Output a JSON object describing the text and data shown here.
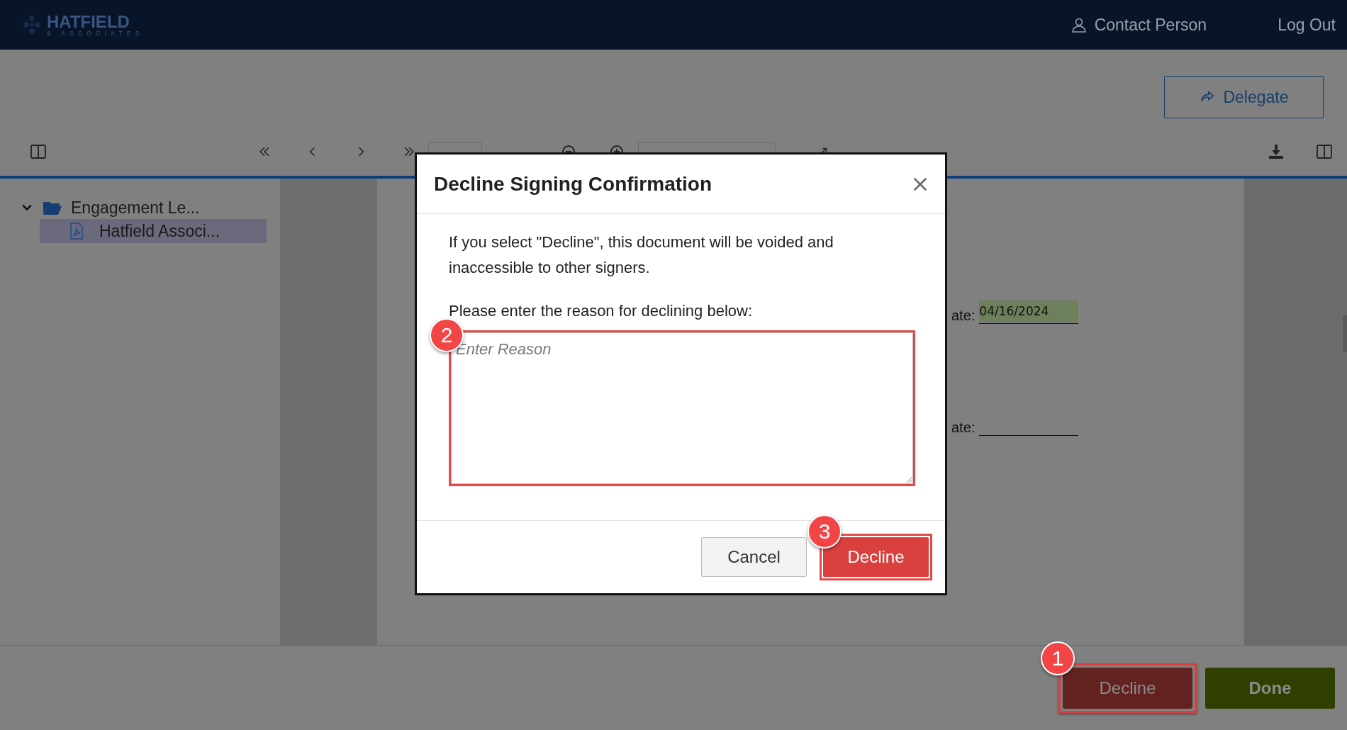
{
  "header": {
    "logo": {
      "name": "HATFIELD",
      "tagline": "& ASSOCIATES"
    },
    "user": "Contact Person",
    "logout": "Log Out"
  },
  "actions": {
    "delegate": "Delegate"
  },
  "sidebar": {
    "items": [
      {
        "label": "Engagement Le...",
        "kind": "folder",
        "expanded": true,
        "children": [
          {
            "label": "Hatfield Associ...",
            "kind": "pdf",
            "selected": true
          }
        ]
      }
    ]
  },
  "document": {
    "fields": [
      {
        "label": "ate:",
        "value": "04/16/2024"
      },
      {
        "label": "ate:"
      }
    ]
  },
  "footer": {
    "buttons": [
      {
        "label": "Decline",
        "kind": "decline",
        "callout": "1"
      },
      {
        "label": "Done",
        "kind": "done"
      }
    ]
  },
  "dialog": {
    "title": "Decline Signing Confirmation",
    "message": "If you select \"Decline\", this document will be voided and inaccessible to other signers.",
    "prompt": "Please enter the reason for declining below:",
    "reason": {
      "placeholder": "Enter Reason",
      "callout": "2"
    },
    "buttons": [
      {
        "label": "Cancel",
        "kind": "secondary"
      },
      {
        "label": "Decline",
        "kind": "danger",
        "callout": "3"
      }
    ]
  }
}
